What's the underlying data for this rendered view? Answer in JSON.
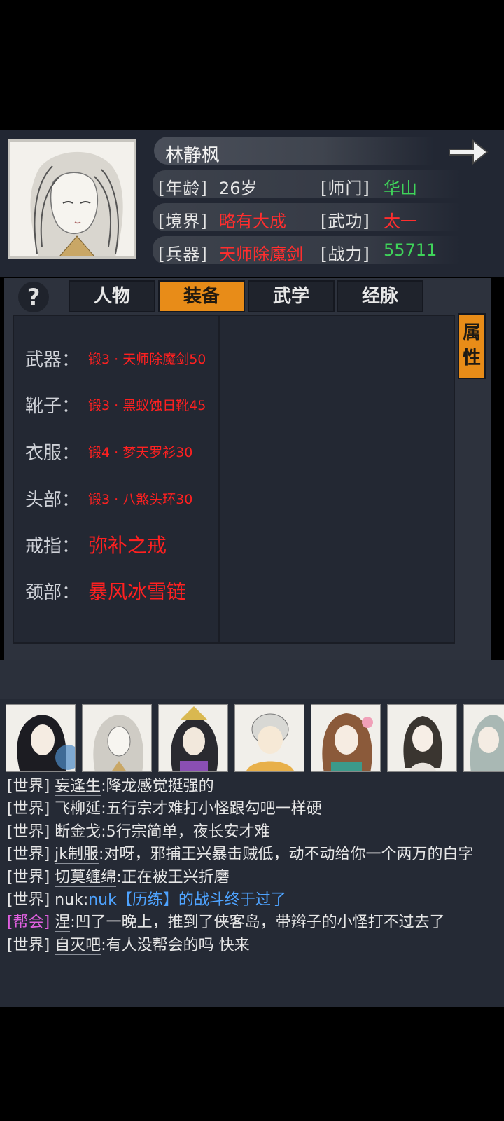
{
  "character": {
    "name": "林静枫",
    "stats": [
      {
        "label": "[年龄]",
        "value": "26岁",
        "color": "#e6e6e6"
      },
      {
        "label": "[师门]",
        "value": "华山",
        "color": "#3fd45a"
      },
      {
        "label": "[境界]",
        "value": "略有大成",
        "color": "#ff2e2e"
      },
      {
        "label": "[武功]",
        "value": "太一",
        "color": "#ff2e2e"
      },
      {
        "label": "[兵器]",
        "value": "天师除魔剑",
        "color": "#ff2e2e"
      },
      {
        "label": "[战力]",
        "value": "55711",
        "color": "#3fd45a"
      }
    ]
  },
  "tabs": [
    {
      "label": "人物",
      "active": false
    },
    {
      "label": "装备",
      "active": true
    },
    {
      "label": "武学",
      "active": false
    },
    {
      "label": "经脉",
      "active": false
    }
  ],
  "help_label": "?",
  "attr_button": {
    "line1": "属",
    "line2": "性"
  },
  "equipment": [
    {
      "label": "武器：",
      "item": "锻3 · 天师除魔剑50"
    },
    {
      "label": "靴子：",
      "item": "锻3 · 黑蚁蚀日靴45"
    },
    {
      "label": "衣服：",
      "item": "锻4 · 梦天罗衫30"
    },
    {
      "label": "头部：",
      "item": "锻3 · 八煞头环30"
    },
    {
      "label": "戒指：",
      "item": "弥补之戒"
    },
    {
      "label": "颈部：",
      "item": "暴风冰雪链"
    }
  ],
  "chat": [
    {
      "channel": "[世界]",
      "sender": "妄逢生",
      "text": ":降龙感觉挺强的"
    },
    {
      "channel": "[世界]",
      "sender": "飞柳延",
      "text": ":五行宗才难打小怪跟勾吧一样硬"
    },
    {
      "channel": "[世界]",
      "sender": "断金戈",
      "text": ":5行宗简单，夜长安才难"
    },
    {
      "channel": "[世界]",
      "sender": "jk制服",
      "text": ":对呀，邪捕王兴暴击贼低，动不动给你一个两万的白字"
    },
    {
      "channel": "[世界]",
      "sender": "切莫缠绵",
      "text": ":正在被王兴折磨"
    },
    {
      "channel": "[世界]",
      "sender": "nuk",
      "text": ":",
      "link": "nuk【历练】的战斗终于过了"
    },
    {
      "channel": "[帮会]",
      "sender": "涅",
      "text": ":凹了一晚上，推到了侠客岛，带辫子的小怪打不过去了"
    },
    {
      "channel": "[世界]",
      "sender": "自灭吧",
      "text": ":有人没帮会的吗 快来"
    }
  ]
}
